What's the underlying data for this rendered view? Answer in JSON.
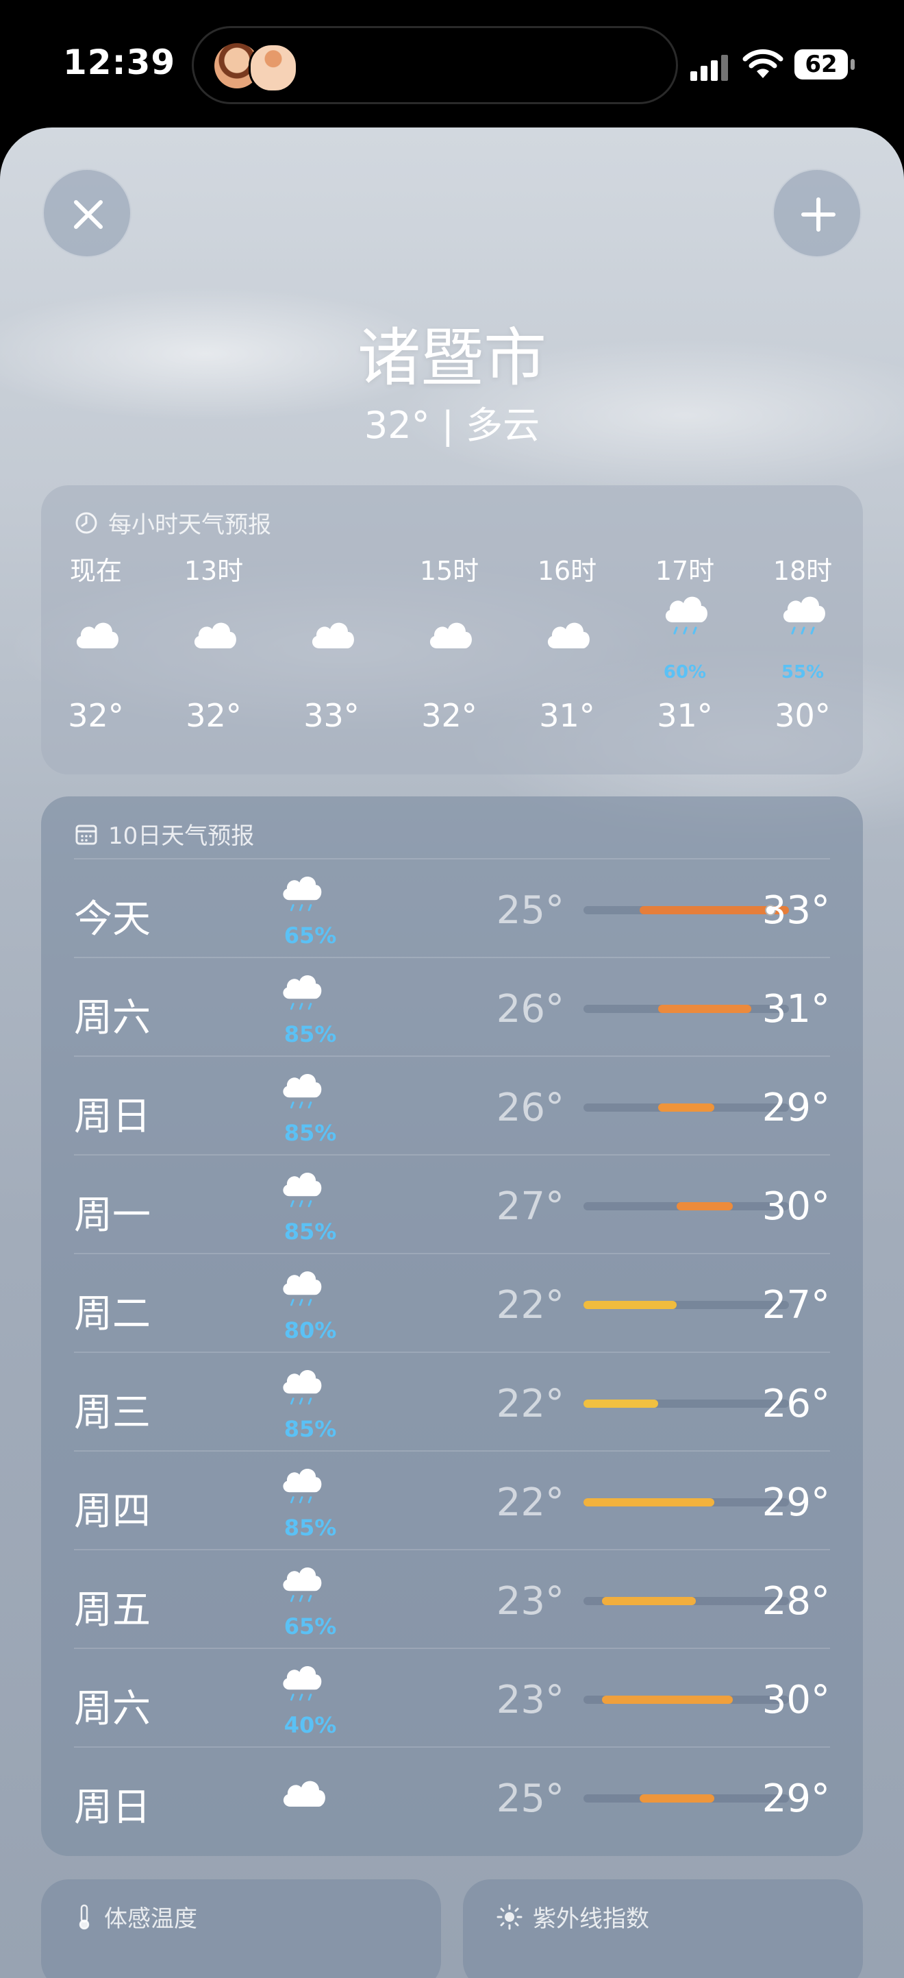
{
  "status_bar": {
    "time": "12:39",
    "battery": "62"
  },
  "location": {
    "city": "诸暨市",
    "summary": "32° | 多云"
  },
  "hourly": {
    "title": "每小时天气预报",
    "items": [
      {
        "label": "现在",
        "icon": "cloud-icon",
        "precip": "",
        "temp": "32°"
      },
      {
        "label": "13时",
        "icon": "cloud-icon",
        "precip": "",
        "temp": "32°"
      },
      {
        "label": "",
        "icon": "cloud-icon",
        "precip": "",
        "temp": "33°"
      },
      {
        "label": "15时",
        "icon": "cloud-icon",
        "precip": "",
        "temp": "32°"
      },
      {
        "label": "16时",
        "icon": "cloud-icon",
        "precip": "",
        "temp": "31°"
      },
      {
        "label": "17时",
        "icon": "rain-cloud-icon",
        "precip": "60%",
        "temp": "31°"
      },
      {
        "label": "18时",
        "icon": "rain-cloud-icon",
        "precip": "55%",
        "temp": "30°"
      }
    ]
  },
  "daily": {
    "title": "10日天气预报",
    "range_min": 22,
    "range_max": 33,
    "days": [
      {
        "name": "今天",
        "icon": "rain-cloud-icon",
        "precip": "65%",
        "low": "25°",
        "high": "33°",
        "low_v": 25,
        "high_v": 33,
        "current_v": 32,
        "color": "#e67e3a"
      },
      {
        "name": "周六",
        "icon": "rain-cloud-icon",
        "precip": "85%",
        "low": "26°",
        "high": "31°",
        "low_v": 26,
        "high_v": 31,
        "color": "#ec8a3c"
      },
      {
        "name": "周日",
        "icon": "rain-cloud-icon",
        "precip": "85%",
        "low": "26°",
        "high": "29°",
        "low_v": 26,
        "high_v": 29,
        "color": "#ef943a"
      },
      {
        "name": "周一",
        "icon": "rain-cloud-icon",
        "precip": "85%",
        "low": "27°",
        "high": "30°",
        "low_v": 27,
        "high_v": 30,
        "color": "#ed8b3b"
      },
      {
        "name": "周二",
        "icon": "rain-cloud-icon",
        "precip": "80%",
        "low": "22°",
        "high": "27°",
        "low_v": 22,
        "high_v": 27,
        "color": "#f1bc3e"
      },
      {
        "name": "周三",
        "icon": "rain-cloud-icon",
        "precip": "85%",
        "low": "22°",
        "high": "26°",
        "low_v": 22,
        "high_v": 26,
        "color": "#f1c040"
      },
      {
        "name": "周四",
        "icon": "rain-cloud-icon",
        "precip": "85%",
        "low": "22°",
        "high": "29°",
        "low_v": 22,
        "high_v": 29,
        "color": "#f2b23d"
      },
      {
        "name": "周五",
        "icon": "rain-cloud-icon",
        "precip": "65%",
        "low": "23°",
        "high": "28°",
        "low_v": 23,
        "high_v": 28,
        "color": "#f2ae3d"
      },
      {
        "name": "周六",
        "icon": "rain-cloud-icon",
        "precip": "40%",
        "low": "23°",
        "high": "30°",
        "low_v": 23,
        "high_v": 30,
        "color": "#f0a03c"
      },
      {
        "name": "周日",
        "icon": "cloud-icon",
        "precip": "",
        "low": "25°",
        "high": "29°",
        "low_v": 25,
        "high_v": 29,
        "color": "#ee963b"
      }
    ]
  },
  "widgets": {
    "feels_like_title": "体感温度",
    "uv_title": "紫外线指数"
  }
}
